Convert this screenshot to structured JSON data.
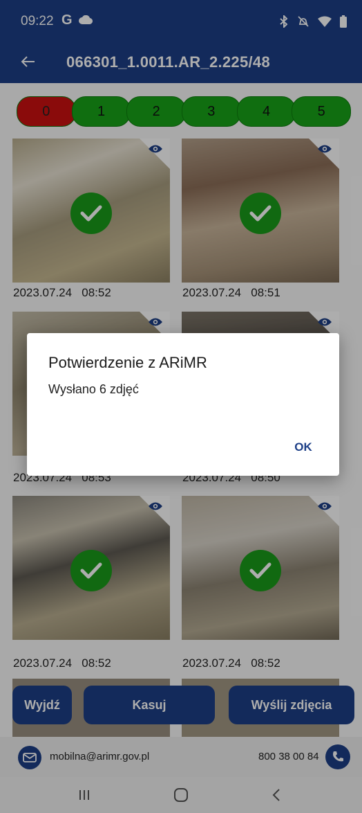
{
  "status_bar": {
    "time": "09:22",
    "g_label": "G"
  },
  "app_bar": {
    "title": "066301_1.0011.AR_2.225/48"
  },
  "filters": [
    "0",
    "1",
    "2",
    "3",
    "4",
    "5"
  ],
  "photos": [
    {
      "date": "2023.07.24",
      "time": "08:52"
    },
    {
      "date": "2023.07.24",
      "time": "08:51"
    },
    {
      "date": "2023.07.24",
      "time": "08:53"
    },
    {
      "date": "2023.07.24",
      "time": "08:50"
    },
    {
      "date": "2023.07.24",
      "time": "08:52"
    },
    {
      "date": "2023.07.24",
      "time": "08:52"
    }
  ],
  "buttons": {
    "exit": "Wyjdź",
    "delete": "Kasuj",
    "send": "Wyślij zdjęcia"
  },
  "contact": {
    "email": "mobilna@arimr.gov.pl",
    "phone": "800 38 00 84"
  },
  "dialog": {
    "title": "Potwierdzenie z ARiMR",
    "message": "Wysłano 6 zdjęć",
    "ok": "OK"
  },
  "colors": {
    "primary": "#1d3f87",
    "filter_green": "#19a319",
    "filter_red": "#cc1111",
    "check_green": "#1a9b1a"
  }
}
